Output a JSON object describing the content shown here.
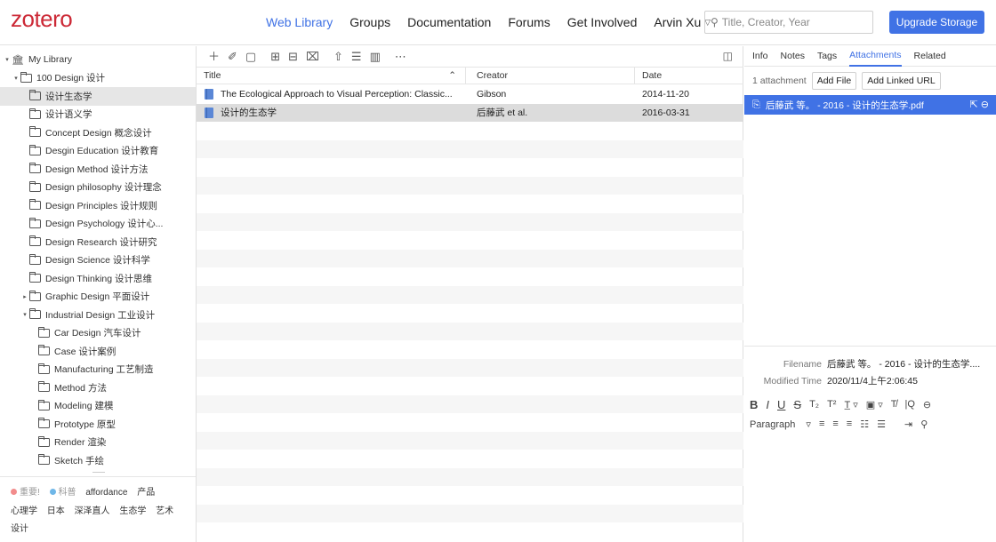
{
  "header": {
    "logo": "zotero",
    "nav": [
      "Web Library",
      "Groups",
      "Documentation",
      "Forums",
      "Get Involved"
    ],
    "user": "Arvin Xu",
    "search_placeholder": "Title, Creator, Year",
    "upgrade_label": "Upgrade Storage"
  },
  "sidebar": {
    "library": "My Library",
    "tree": [
      {
        "label": "100 Design 设计",
        "indent": 1,
        "twisty": "▾"
      },
      {
        "label": "设计生态学",
        "indent": 2,
        "twisty": "",
        "selected": true
      },
      {
        "label": "设计语义学",
        "indent": 2,
        "twisty": ""
      },
      {
        "label": "Concept Design 概念设计",
        "indent": 2,
        "twisty": ""
      },
      {
        "label": "Desgin Education 设计教育",
        "indent": 2,
        "twisty": ""
      },
      {
        "label": "Design Method 设计方法",
        "indent": 2,
        "twisty": ""
      },
      {
        "label": "Design philosophy 设计理念",
        "indent": 2,
        "twisty": ""
      },
      {
        "label": "Design Principles 设计规则",
        "indent": 2,
        "twisty": ""
      },
      {
        "label": "Design Psychology 设计心...",
        "indent": 2,
        "twisty": ""
      },
      {
        "label": "Design Research 设计研究",
        "indent": 2,
        "twisty": ""
      },
      {
        "label": "Design Science 设计科学",
        "indent": 2,
        "twisty": ""
      },
      {
        "label": "Design Thinking 设计思维",
        "indent": 2,
        "twisty": ""
      },
      {
        "label": "Graphic Design 平面设计",
        "indent": 2,
        "twisty": "▸"
      },
      {
        "label": "Industrial Design 工业设计",
        "indent": 2,
        "twisty": "▾"
      },
      {
        "label": "Car Design 汽车设计",
        "indent": 3,
        "twisty": ""
      },
      {
        "label": "Case 设计案例",
        "indent": 3,
        "twisty": ""
      },
      {
        "label": "Manufacturing 工艺制造",
        "indent": 3,
        "twisty": ""
      },
      {
        "label": "Method 方法",
        "indent": 3,
        "twisty": ""
      },
      {
        "label": "Modeling 建模",
        "indent": 3,
        "twisty": ""
      },
      {
        "label": "Prototype 原型",
        "indent": 3,
        "twisty": ""
      },
      {
        "label": "Render 渲染",
        "indent": 3,
        "twisty": ""
      },
      {
        "label": "Sketch 手绘",
        "indent": 3,
        "twisty": ""
      }
    ],
    "tags": [
      {
        "label": "重要!",
        "color": "#f28c8c"
      },
      {
        "label": "科普",
        "color": "#6fb7e8"
      },
      {
        "label": "affordance"
      },
      {
        "label": "产品"
      },
      {
        "label": "心理学"
      },
      {
        "label": "日本"
      },
      {
        "label": "深泽直人"
      },
      {
        "label": "生态学"
      },
      {
        "label": "艺术"
      },
      {
        "label": "设计"
      }
    ]
  },
  "items": {
    "columns": {
      "title": "Title",
      "creator": "Creator",
      "date": "Date"
    },
    "rows": [
      {
        "title": "The Ecological Approach to Visual Perception: Classic...",
        "creator": "Gibson",
        "date": "2014-11-20"
      },
      {
        "title": "设计的生态学",
        "creator": "后藤武 et al.",
        "date": "2016-03-31"
      }
    ]
  },
  "details": {
    "tabs": [
      "Info",
      "Notes",
      "Tags",
      "Attachments",
      "Related"
    ],
    "active_tab": "Attachments",
    "attachment_count": "1 attachment",
    "add_file": "Add File",
    "add_linked_url": "Add Linked URL",
    "attachment_name": "后藤武 等。 - 2016 - 设计的生态学.pdf",
    "filename_label": "Filename",
    "filename_value": "后藤武 等。 - 2016 - 设计的生态学....",
    "modified_label": "Modified Time",
    "modified_value": "2020/11/4上午2:06:45",
    "paragraph_label": "Paragraph"
  },
  "colors": {
    "accent": "#4072e5",
    "brand": "#cc2936"
  }
}
